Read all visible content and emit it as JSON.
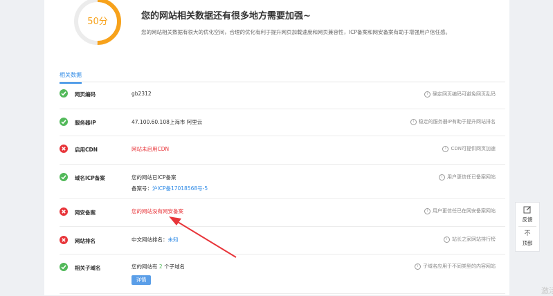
{
  "score": {
    "value": 50,
    "label": "50分",
    "accent": "#f7a21b"
  },
  "header": {
    "headline": "您的网站相关数据还有很多地方需要加强~",
    "description": "您的网站相关数据有很大的优化空间，合理的优化有利于提升网页加载速度和网页兼容性，ICP备案和网安备案有助于增强用户信任感。"
  },
  "tab": {
    "label": "相关数据"
  },
  "rows": [
    {
      "status": "ok",
      "label": "网页编码",
      "value": "gb2312",
      "tip": "确定网页编码可避免网页乱码"
    },
    {
      "status": "ok",
      "label": "服务器IP",
      "value": "47.100.60.108上海市 阿里云",
      "tip": "稳定的服务器IP有助于提升网站排名"
    },
    {
      "status": "fail",
      "label": "启用CDN",
      "value": "网站未启用CDN",
      "tip": "CDN可提供网页加速"
    },
    {
      "status": "ok",
      "label": "域名ICP备案",
      "value": "您的网站已ICP备案",
      "sub_prefix": "备案号：",
      "sub_link": "沪ICP备17018568号-5",
      "tip": "用户更信任已备案网站"
    },
    {
      "status": "fail",
      "label": "网安备案",
      "value": "您的网站没有网安备案",
      "tip": "用户更信任已在网安备案网站"
    },
    {
      "status": "fail",
      "label": "网站排名",
      "value_prefix": "中文网站排名：",
      "value_link": "未知",
      "tip": "站长之家网站排行榜"
    },
    {
      "status": "ok",
      "label": "相关子域名",
      "value_prefix": "您的网站有",
      "value_count": "2",
      "value_suffix": "个子域名",
      "button": "详情",
      "tip": "子域名应用于不同类型的内容网站"
    }
  ],
  "side": {
    "feedback": "反馈",
    "top": "顶部"
  },
  "watermark": "激活",
  "colors": {
    "ok": "#52b95a",
    "fail": "#e8353a",
    "link": "#2e8ae6",
    "arrow": "#e8353a"
  }
}
